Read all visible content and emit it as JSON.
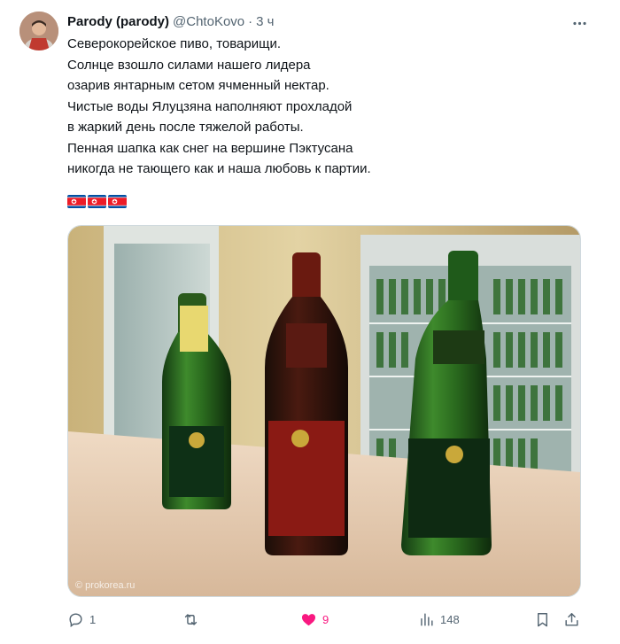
{
  "author": {
    "name": "Parody (parody)",
    "handle": "@ChtoKovo",
    "separator": "·",
    "time": "3 ч"
  },
  "tweet": {
    "lines": [
      "Северокорейское пиво, товарищи.",
      "Солнце взошло силами нашего лидера",
      "озарив янтарным сетом ячменный нектар.",
      "Чистые воды Ялуцзяна наполняют прохладой",
      "в жаркий день после тяжелой работы.",
      "Пенная шапка как снег на вершине Пэктусана",
      "никогда не тающего как и наша любовь к партии."
    ],
    "flag_count": 3
  },
  "media": {
    "watermark": "© prokorea.ru"
  },
  "actions": {
    "reply_count": "1",
    "retweet_count": "",
    "like_count": "9",
    "views_count": "148"
  },
  "icons": {
    "more": "more-horizontal-icon",
    "reply": "reply-icon",
    "retweet": "retweet-icon",
    "like": "heart-filled-icon",
    "views": "views-chart-icon",
    "bookmark": "bookmark-icon",
    "share": "share-icon"
  },
  "colors": {
    "text": "#0f1419",
    "secondary": "#536471",
    "like": "#f91880",
    "flag_blue": "#024fa2",
    "flag_red": "#ed1c27"
  }
}
